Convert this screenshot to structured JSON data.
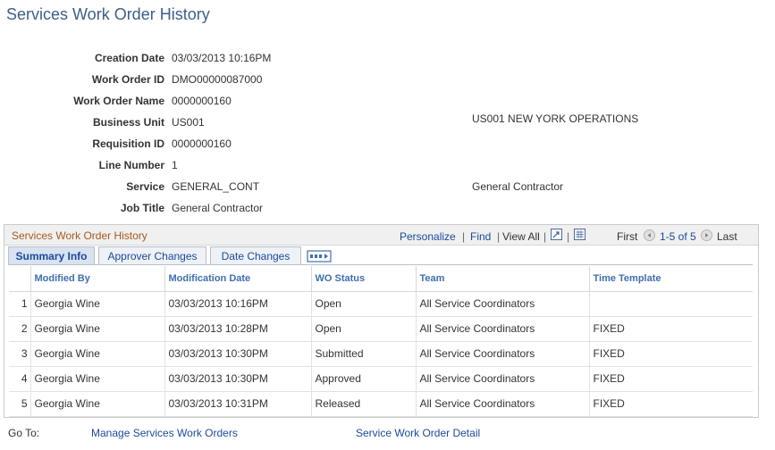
{
  "page": {
    "title": "Services Work Order History"
  },
  "fields": [
    {
      "label": "Creation Date",
      "value": "03/03/2013 10:16PM",
      "extra": ""
    },
    {
      "label": "Work Order ID",
      "value": "DMO00000087000",
      "extra": ""
    },
    {
      "label": "Work Order Name",
      "value": "0000000160",
      "extra": ""
    },
    {
      "label": "Business Unit",
      "value": "US001",
      "extra": "US001 NEW YORK OPERATIONS"
    },
    {
      "label": "Requisition ID",
      "value": "0000000160",
      "extra": ""
    },
    {
      "label": "Line Number",
      "value": "1",
      "extra": ""
    },
    {
      "label": "Service",
      "value": "GENERAL_CONT",
      "extra": "General Contractor"
    },
    {
      "label": "Job Title",
      "value": "General Contractor",
      "extra": ""
    }
  ],
  "grid": {
    "title": "Services Work Order History",
    "personalize": "Personalize",
    "find": "Find",
    "view_all": "View All",
    "first": "First",
    "range": "1-5 of 5",
    "last": "Last",
    "sep": "|",
    "tabs": [
      {
        "label": "Summary Info"
      },
      {
        "label": "Approver Changes"
      },
      {
        "label": "Date Changes"
      }
    ],
    "columns": [
      "Modified By",
      "Modification Date",
      "WO Status",
      "Team",
      "Time Template"
    ],
    "rows": [
      {
        "num": "1",
        "modified_by": "Georgia Wine",
        "mod_date": "03/03/2013 10:16PM",
        "status": "Open",
        "team": "All Service Coordinators",
        "template": ""
      },
      {
        "num": "2",
        "modified_by": "Georgia Wine",
        "mod_date": "03/03/2013 10:28PM",
        "status": "Open",
        "team": "All Service Coordinators",
        "template": "FIXED"
      },
      {
        "num": "3",
        "modified_by": "Georgia Wine",
        "mod_date": "03/03/2013 10:30PM",
        "status": "Submitted",
        "team": "All Service Coordinators",
        "template": "FIXED"
      },
      {
        "num": "4",
        "modified_by": "Georgia Wine",
        "mod_date": "03/03/2013 10:30PM",
        "status": "Approved",
        "team": "All Service Coordinators",
        "template": "FIXED"
      },
      {
        "num": "5",
        "modified_by": "Georgia Wine",
        "mod_date": "03/03/2013 10:31PM",
        "status": "Released",
        "team": "All Service Coordinators",
        "template": "FIXED"
      }
    ]
  },
  "footer": {
    "goto_label": "Go To:",
    "links": [
      "Manage Services Work Orders",
      "Service Work Order Detail"
    ]
  },
  "icons": {
    "zoom": "zoom-icon",
    "download": "download-icon",
    "prev": "prev-arrow-icon",
    "next": "next-arrow-icon",
    "show_all_columns": "show-all-columns-icon"
  },
  "colors": {
    "title": "#3d5e8c",
    "grid_title": "#a55a1e",
    "link": "#1a4a9c",
    "column_header": "#3f6fb0"
  }
}
